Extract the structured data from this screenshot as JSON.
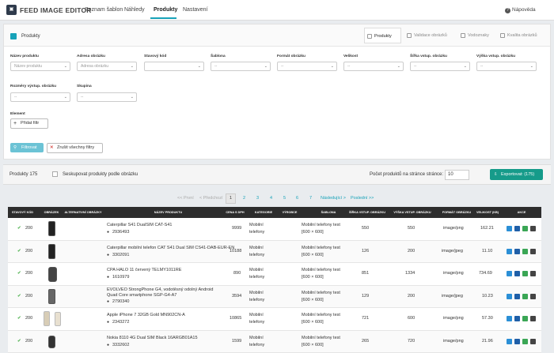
{
  "app": {
    "brand": "FEED IMAGE EDITOR",
    "nav": [
      "Seznam šablon",
      "Náhledy",
      "Produkty",
      "Nastavení"
    ],
    "help": "Nápověda",
    "help_glyph": "?",
    "logo_glyph": "▣"
  },
  "card": {
    "title": "Produkty",
    "tabs": [
      "Produkty",
      "Validace obrázků",
      "Vodoznaky",
      "Kvalita obrázků"
    ]
  },
  "filters": {
    "row1": [
      {
        "label": "Název produktu",
        "placeholder": "Název produktu"
      },
      {
        "label": "Adresa obrázku",
        "placeholder": "Adresa obrázku"
      },
      {
        "label": "Stavový kód",
        "placeholder": ""
      },
      {
        "label": "Šablona",
        "placeholder": "--"
      },
      {
        "label": "Formát obrázku",
        "placeholder": "--"
      },
      {
        "label": "Velikost",
        "placeholder": "--"
      },
      {
        "label": "Šířka vstup. obrázku",
        "placeholder": "--"
      },
      {
        "label": "Výška vstup. obrázku",
        "placeholder": "--"
      }
    ],
    "row2": [
      {
        "label": "Rozměry výstup. obrázku",
        "placeholder": "--"
      },
      {
        "label": "Skupina",
        "placeholder": "--"
      }
    ],
    "element_label": "Element",
    "add_filter": "Přidat filtr",
    "apply": "Filtrovat",
    "clear": "Zrušit všechny filtry"
  },
  "toolbar": {
    "count": "Produkty 175",
    "group_label": "Seskupovat produkty podle obrázku",
    "per_page_label": "Počet produktů na stránce stránce:",
    "per_page": "10",
    "export": "Exportovat: (175)",
    "export_glyph": "⇩"
  },
  "pagination": {
    "first": "<< První",
    "prev": "< Předchozí",
    "pages": [
      "1",
      "2",
      "3",
      "4",
      "5",
      "6",
      "7"
    ],
    "next": "Následující >",
    "last": "Poslední >>"
  },
  "table": {
    "headers": [
      "STAVOVÝ KÓD",
      "OBRÁZEK",
      "ALTERNATIVNÍ OBRÁZKY",
      "NÁZEV PRODUKTU",
      "CENA S DPH",
      "KATEGORIE",
      "VÝROBCE",
      "ŠABLONA",
      "ŠÍŘKA VSTUP. OBRÁZKU",
      "VÝŠKA VSTUP. OBRÁZKU",
      "FORMÁT OBRÁZKU",
      "VELIKOST (KB)",
      "AKCE"
    ],
    "rows": [
      {
        "status": "200",
        "name": "Caterpillar S41 DualSIM CAT-S41",
        "code": "2936493",
        "price": "9999",
        "cat1": "Mobilní",
        "cat2": "telefony",
        "tpl1": "Mobilní telefony test",
        "tpl2": "[600 × 600]",
        "w": "550",
        "h": "550",
        "fmt": "image/png",
        "size": "162.21"
      },
      {
        "status": "200",
        "name": "Caterpillar mobilní telefon CAT S41 Dual SIM CS41-DAB-EUR-EN",
        "code": "3302091",
        "price": "10188",
        "cat1": "Mobilní",
        "cat2": "telefony",
        "tpl1": "Mobilní telefony test",
        "tpl2": "[600 × 600]",
        "w": "126",
        "h": "200",
        "fmt": "image/jpeg",
        "size": "11.10"
      },
      {
        "status": "200",
        "name": "CPA HALO 11 červený TELMY1011RE",
        "code": "1610979",
        "price": "890",
        "cat1": "Mobilní",
        "cat2": "telefony",
        "tpl1": "Mobilní telefony test",
        "tpl2": "[600 × 600]",
        "w": "851",
        "h": "1334",
        "fmt": "image/png",
        "size": "734.69"
      },
      {
        "status": "200",
        "name": "EVOLVEO StrongPhone G4, vodotěsný odolný Android Quad Core smartphone SGP-G4-A7",
        "code": "2790340",
        "price": "3594",
        "cat1": "Mobilní",
        "cat2": "telefony",
        "tpl1": "Mobilní telefony test",
        "tpl2": "[600 × 600]",
        "w": "129",
        "h": "200",
        "fmt": "image/jpeg",
        "size": "10.23"
      },
      {
        "status": "200",
        "name": "Apple iPhone 7 32GB Gold MN902CN-A",
        "code": "2343272",
        "price": "10865",
        "cat1": "Mobilní",
        "cat2": "telefony",
        "tpl1": "Mobilní telefony test",
        "tpl2": "[600 × 600]",
        "w": "721",
        "h": "600",
        "fmt": "image/png",
        "size": "57.30"
      },
      {
        "status": "200",
        "name": "Nokia 8110 4G Dual SIM Black 16ARGB01A15",
        "code": "3332602",
        "price": "1599",
        "cat1": "Mobilní",
        "cat2": "telefony",
        "tpl1": "Mobilní telefony test",
        "tpl2": "[600 × 600]",
        "w": "265",
        "h": "720",
        "fmt": "image/png",
        "size": "21.96"
      }
    ]
  },
  "icons": {
    "check": "✔",
    "tag": "●",
    "caret": "⌄",
    "plus": "+",
    "times": "✕",
    "filter": "⚲"
  },
  "colors": {
    "accent": "#17a2b8",
    "export": "#169b8a",
    "ok": "#5cb85c",
    "head": "#2d2d2d"
  }
}
